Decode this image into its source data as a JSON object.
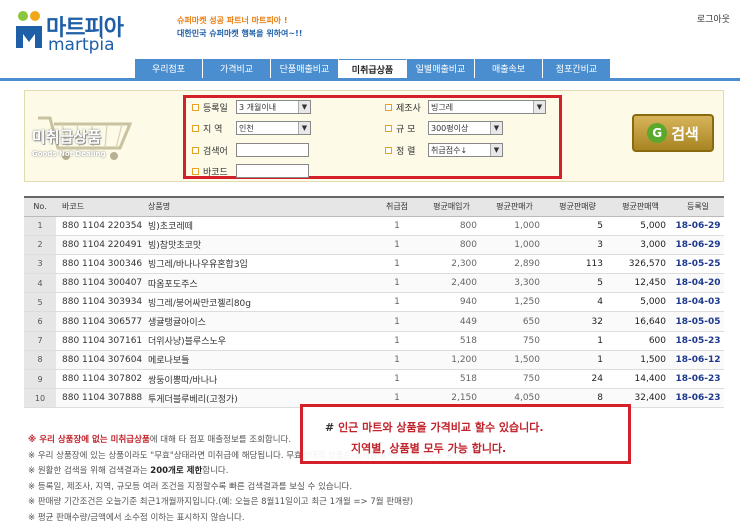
{
  "header": {
    "logo_ko": "마트피아",
    "logo_en": "martpia",
    "slogan_line1": "슈퍼마켓 성공 파트너 마트피아 !",
    "slogan_line2": "대한민국 슈퍼마켓 행복을 위하여~!!",
    "logout": "로그아웃"
  },
  "nav": {
    "items": [
      "우리점포",
      "가격비교",
      "단품매출비교",
      "미취급상품",
      "일별매출비교",
      "매출속보",
      "점포간비교"
    ],
    "active_index": 3
  },
  "search": {
    "panel_title": "미취급상품",
    "panel_subtitle": "Goods Not Dealing",
    "reg_date_label": "등록일",
    "reg_date_value": "3 개월이내",
    "maker_label": "제조사",
    "maker_value": "빙그레",
    "region_label": "지  역",
    "region_value": "인천",
    "scale_label": "규  모",
    "scale_value": "300평이상",
    "keyword_label": "검색어",
    "sort_label": "정  렬",
    "sort_value": "취급점수↓",
    "barcode_label": "바코드",
    "search_button": "검색"
  },
  "table": {
    "headers": [
      "No.",
      "바코드",
      "상품명",
      "취급점",
      "평균매입가",
      "평균판매가",
      "평균판매량",
      "평균판매액",
      "등록일"
    ],
    "rows": [
      [
        "1",
        "880 1104 220354",
        "빙)초코레떼",
        "1",
        "800",
        "1,000",
        "5",
        "5,000",
        "18-06-29"
      ],
      [
        "2",
        "880 1104 220491",
        "빙)참맛초코맛",
        "1",
        "800",
        "1,000",
        "3",
        "3,000",
        "18-06-29"
      ],
      [
        "3",
        "880 1104 300346",
        "빙그레/바나나우유혼합3입",
        "1",
        "2,300",
        "2,890",
        "113",
        "326,570",
        "18-05-25"
      ],
      [
        "4",
        "880 1104 300407",
        "따옴포도주스",
        "1",
        "2,400",
        "3,300",
        "5",
        "12,450",
        "18-04-20"
      ],
      [
        "5",
        "880 1104 303934",
        "빙그레/붕어싸만코젤리80g",
        "1",
        "940",
        "1,250",
        "4",
        "5,000",
        "18-04-03"
      ],
      [
        "6",
        "880 1104 306577",
        "생귤탱귤아이스",
        "1",
        "449",
        "650",
        "32",
        "16,640",
        "18-05-05"
      ],
      [
        "7",
        "880 1104 307161",
        "더위사냥)블루스노우",
        "1",
        "518",
        "750",
        "1",
        "600",
        "18-05-23"
      ],
      [
        "8",
        "880 1104 307604",
        "메로나보틀",
        "1",
        "1,200",
        "1,500",
        "1",
        "1,500",
        "18-06-12"
      ],
      [
        "9",
        "880 1104 307802",
        "쌍둥이뽕따/바나나",
        "1",
        "518",
        "750",
        "24",
        "14,400",
        "18-06-23"
      ],
      [
        "10",
        "880 1104 307888",
        "투게더블루베리(고정가)",
        "1",
        "2,150",
        "4,050",
        "8",
        "32,400",
        "18-06-23"
      ]
    ]
  },
  "notes": {
    "n1_red": "※ 우리 상품장에 없는 미취급상품",
    "n1_rest": "에 대해 타 점포 매출정보를 조회합니다.",
    "n2": "※ 우리 상품장에 있는 상품이라도 \"무효\"상태라면 미취급에 해당됩니다. 무효상태의 상품은 상세창에 \"무효\"상품으로 표시됩니다.",
    "n3_pre": "※ 원활한 검색을 위해 검색결과는 ",
    "n3_bold": "200개로 제한",
    "n3_post": "합니다.",
    "n4": "※ 등록일, 제조사, 지역, 규모등 여러 조건을 지정할수록 빠른 검색결과를 보실 수 있습니다.",
    "n5": "※ 판매량 기간조건은 오늘기준 최근1개월까지입니다.(예: 오늘은 8월11일이고 최근 1개월 => 7월 판매량)",
    "n6": "※ 평균 판매수량/금액에서 소수점 이하는 표시하지 않습니다."
  },
  "callout": {
    "hash": "#",
    "line1": "인근 마트와 상품을 가격비교 할수 있습니다.",
    "line2": "지역별, 상품별 모두 가능 합니다."
  },
  "colors": {
    "nav_blue": "#4a8ed0",
    "brand_blue": "#1e5fa8",
    "highlight_red": "#d4202a",
    "date_blue": "#1e3a8c"
  }
}
